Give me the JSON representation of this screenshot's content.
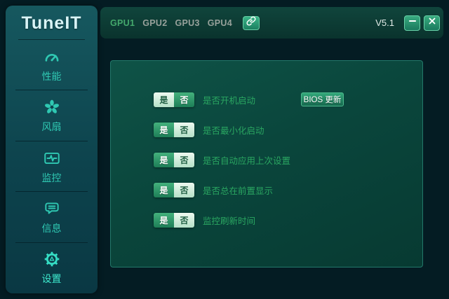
{
  "window": {
    "logo": "TuneIT",
    "version": "V5.1"
  },
  "topbar": {
    "gpu_tabs": [
      {
        "label": "GPU1",
        "active": true
      },
      {
        "label": "GPU2",
        "active": false
      },
      {
        "label": "GPU3",
        "active": false
      },
      {
        "label": "GPU4",
        "active": false
      }
    ]
  },
  "sidebar": {
    "items": [
      {
        "label": "性能",
        "icon": "gauge-icon",
        "active": false
      },
      {
        "label": "风扇",
        "icon": "fan-icon",
        "active": false
      },
      {
        "label": "监控",
        "icon": "monitor-icon",
        "active": false
      },
      {
        "label": "信息",
        "icon": "message-icon",
        "active": false
      },
      {
        "label": "设置",
        "icon": "gear-icon",
        "active": true
      }
    ]
  },
  "settings": {
    "yes_label": "是",
    "no_label": "否",
    "rows": [
      {
        "label": "是否开机启动",
        "selected": "是",
        "extra_button": "BIOS 更新"
      },
      {
        "label": "是否最小化启动",
        "selected": "否"
      },
      {
        "label": "是否自动应用上次设置",
        "selected": "否"
      },
      {
        "label": "是否总在前置显示",
        "selected": "否"
      },
      {
        "label": "监控刷新时间",
        "selected": "否"
      }
    ]
  },
  "colors": {
    "accent_cyan": "#2fc8b2",
    "active_tab_green": "#44a96c",
    "row_label_green": "#2aa661",
    "button_green": "#2ea77c",
    "panel_border": "#23786a"
  }
}
